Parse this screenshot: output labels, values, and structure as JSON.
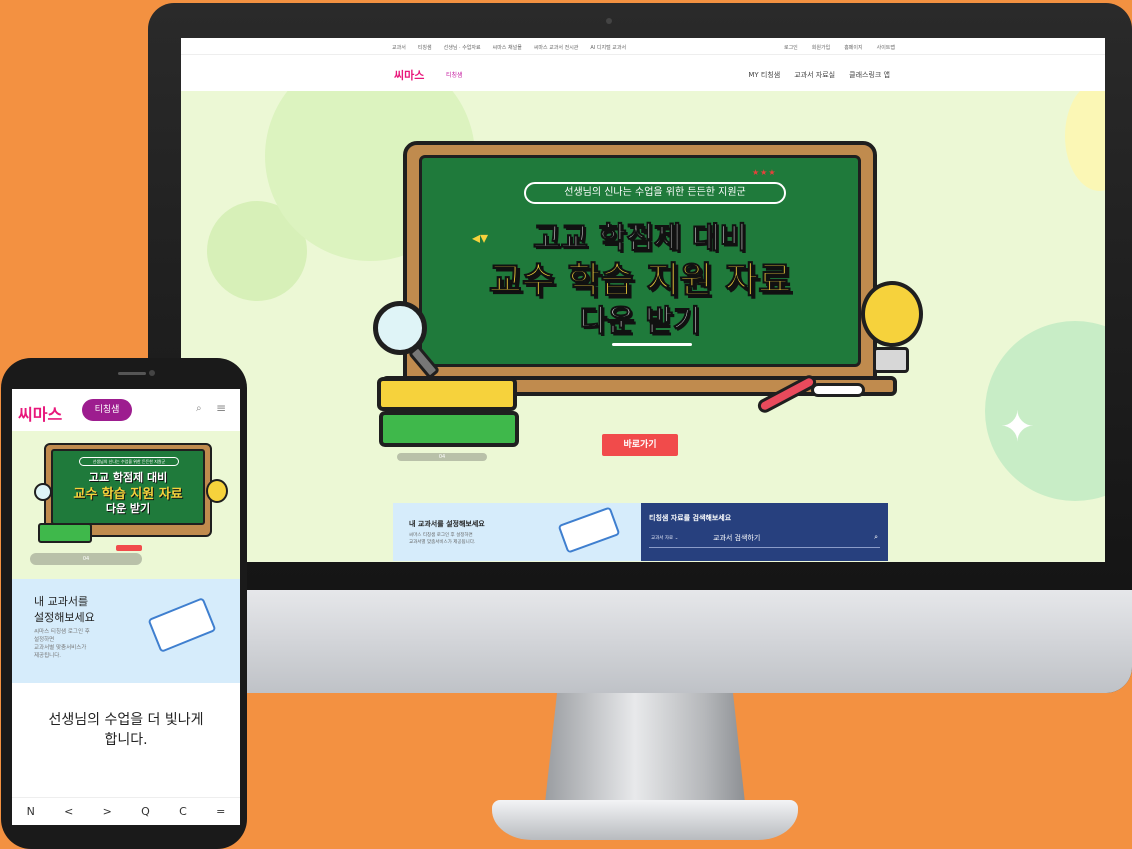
{
  "desktop": {
    "util_links": [
      "교과서",
      "티칭샘",
      "선생님 · 수업자료",
      "씨마스 채널몰",
      "씨마스 교과서 전시관",
      "AI 디지털 교과서"
    ],
    "util_right": [
      "로그인",
      "회원가입",
      "홈페이지",
      "사이트맵"
    ],
    "logo": "씨마스",
    "logo_sub": "티칭샘",
    "nav": [
      "MY 티칭샘",
      "교과서 자료실",
      "클래스링크 앱"
    ],
    "hero": {
      "pill": "선생님의 신나는 수업을 위한 든든한 지원군",
      "stars": "★★★",
      "line1": "고교 학점제 대비",
      "line2": "교수 학습 지원 자료",
      "line3": "다운 받기",
      "button": "바로가기",
      "pager": "04"
    },
    "panel_left": {
      "title": "내 교과서를 설정해보세요",
      "sub1": "씨마스 티칭샘 로그인 후 설정하면",
      "sub2": "교과서별 맞춤서비스가 제공됩니다."
    },
    "panel_right": {
      "title": "티칭샘 자료를 검색해보세요",
      "select": "교과서 자료",
      "placeholder": "교과서 검색하기"
    }
  },
  "mobile": {
    "logo": "씨마스",
    "badge": "티칭샘",
    "hero": {
      "pill": "선생님의 신나는 수업을 위한 든든한 지원군",
      "line1": "고교 학점제 대비",
      "line2": "교수 학습 지원 자료",
      "line3": "다운 받기",
      "pager": "04"
    },
    "card": {
      "title1": "내 교과서를",
      "title2": "설정해보세요",
      "sub": [
        "씨마스 티칭샘 로그인 후",
        "설정하면",
        "교과서별 맞춤서비스가",
        "제공됩니다."
      ]
    },
    "message1": "선생님의 수업을 더 빛나게",
    "message2": "합니다.",
    "bottom_bar": [
      "N",
      "<",
      ">",
      "Q",
      "C",
      "="
    ]
  },
  "colors": {
    "background": "#f39141",
    "brand": "#e8177b",
    "board": "#1f7a3b",
    "button": "#f14b4b",
    "search_panel": "#27407e"
  }
}
